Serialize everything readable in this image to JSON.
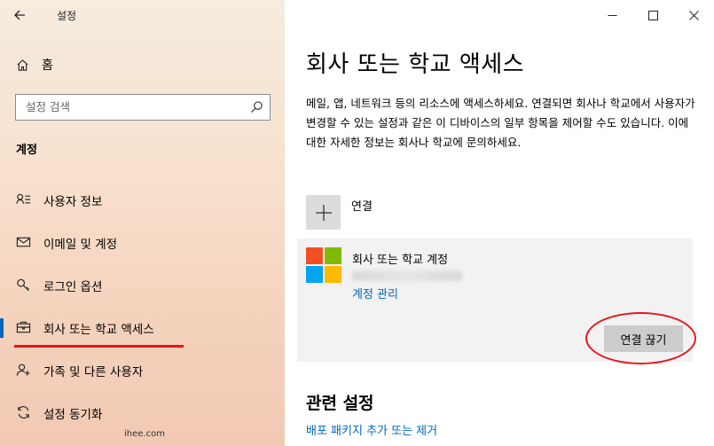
{
  "window": {
    "title": "설정",
    "minimize_icon": "minimize-icon",
    "maximize_icon": "maximize-icon",
    "close_icon": "close-icon"
  },
  "sidebar": {
    "home_label": "홈",
    "search_placeholder": "설정 검색",
    "section_heading": "계정",
    "items": [
      {
        "label": "사용자 정보",
        "icon": "user-info-icon"
      },
      {
        "label": "이메일 및 계정",
        "icon": "mail-icon"
      },
      {
        "label": "로그인 옵션",
        "icon": "key-icon"
      },
      {
        "label": "회사 또는 학교 액세스",
        "icon": "briefcase-icon",
        "active": true
      },
      {
        "label": "가족 및 다른 사용자",
        "icon": "add-person-icon"
      },
      {
        "label": "설정 동기화",
        "icon": "sync-icon"
      }
    ],
    "watermark": "ihee.com"
  },
  "main": {
    "title": "회사 또는 학교 액세스",
    "description": "메일, 앱, 네트워크 등의 리소스에 액세스하세요. 연결되면 회사나 학교에서 사용자가 변경할 수 있는 설정과 같은 이 디바이스의 일부 항목을 제어할 수도 있습니다. 이에 대한 자세한 정보는 회사나 학교에 문의하세요.",
    "connect_label": "연결",
    "account": {
      "name": "회사 또는 학교 계정",
      "manage_link": "계정 관리",
      "disconnect_label": "연결 끊기"
    },
    "related": {
      "title": "관련 설정",
      "link": "배포 패키지 추가 또는 제거"
    }
  },
  "colors": {
    "accent": "#0067c0",
    "annotation_red": "#e8141a",
    "ms_red": "#f25022",
    "ms_green": "#7fba00",
    "ms_blue": "#00a4ef",
    "ms_yellow": "#ffb900"
  }
}
